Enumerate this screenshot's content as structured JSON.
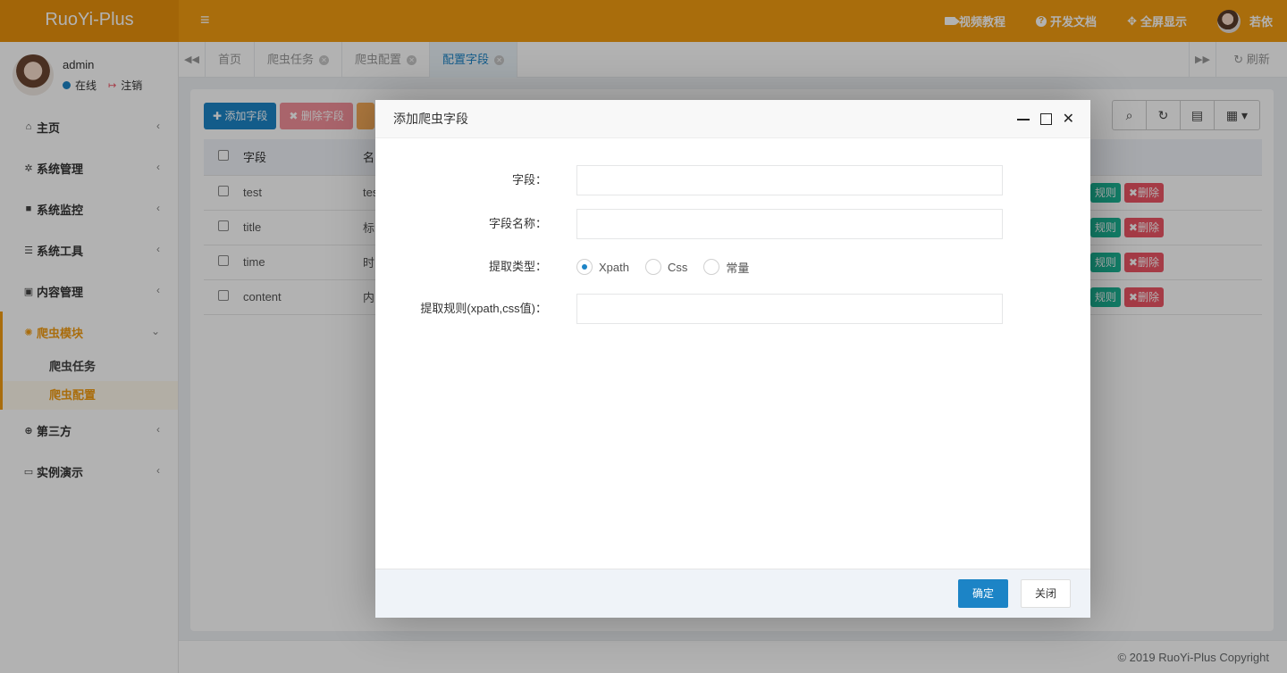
{
  "app": {
    "logo": "RuoYi-Plus"
  },
  "header": {
    "menu_icon": "hamburger-icon",
    "video": "视频教程",
    "docs": "开发文档",
    "fullscreen": "全屏显示",
    "user": "若依"
  },
  "profile": {
    "name": "admin",
    "online": "在线",
    "logout": "注销"
  },
  "sidebar": {
    "items": [
      {
        "label": "主页",
        "icon": "home-icon"
      },
      {
        "label": "系统管理",
        "icon": "gear-icon"
      },
      {
        "label": "系统监控",
        "icon": "video-icon"
      },
      {
        "label": "系统工具",
        "icon": "bars-icon"
      },
      {
        "label": "内容管理",
        "icon": "id-card-icon"
      },
      {
        "label": "爬虫模块",
        "icon": "bug-icon"
      },
      {
        "label": "第三方",
        "icon": "lifebuoy-icon"
      },
      {
        "label": "实例演示",
        "icon": "desktop-icon"
      }
    ],
    "sub": [
      "爬虫任务",
      "爬虫配置"
    ]
  },
  "tabs": {
    "items": [
      "首页",
      "爬虫任务",
      "爬虫配置",
      "配置字段"
    ],
    "refresh": "刷新"
  },
  "toolbar": {
    "add": "添加字段",
    "delete": "删除字段"
  },
  "table": {
    "headers": [
      "字段",
      "名"
    ],
    "rows": [
      {
        "field": "test",
        "name": "tes"
      },
      {
        "field": "title",
        "name": "标"
      },
      {
        "field": "time",
        "name": "时"
      },
      {
        "field": "content",
        "name": "内"
      }
    ],
    "action_rule": "规则",
    "action_delete": "删除"
  },
  "modal": {
    "title": "添加爬虫字段",
    "field_label": "字段：",
    "field_value": "",
    "name_label": "字段名称：",
    "name_value": "",
    "type_label": "提取类型：",
    "types": [
      "Xpath",
      "Css",
      "常量"
    ],
    "selected_type": "Xpath",
    "rule_label": "提取规则(xpath,css值)：",
    "rule_value": "",
    "ok": "确定",
    "close": "关闭"
  },
  "footer": {
    "copyright": "© 2019 RuoYi-Plus Copyright"
  },
  "colors": {
    "accent": "#f39c12",
    "primary": "#1c84c6",
    "danger": "#ed5565",
    "success": "#1ab394"
  }
}
